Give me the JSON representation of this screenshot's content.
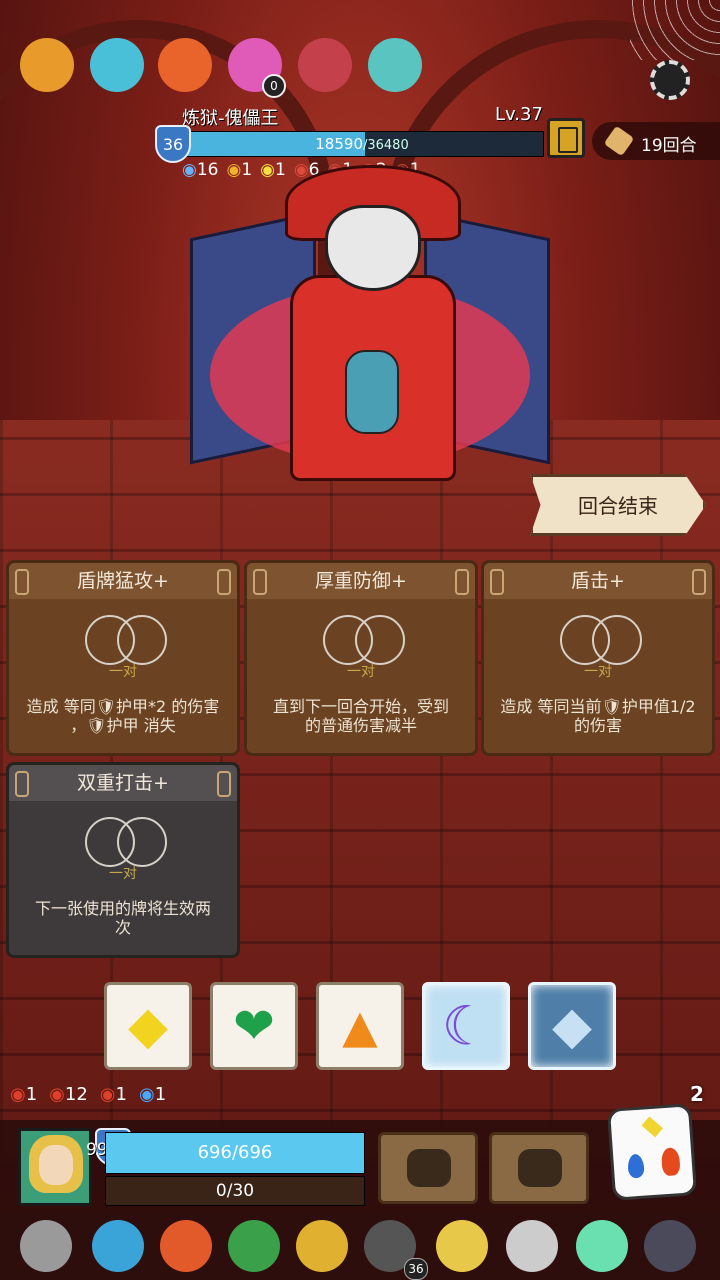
{
  "top_relics": [
    {
      "icon": "pumpkin-mask-icon",
      "color": "#e89a2a"
    },
    {
      "icon": "green-coral-icon",
      "color": "#4ac0d8"
    },
    {
      "icon": "fire-mirror-icon",
      "color": "#e8642a"
    },
    {
      "icon": "pink-orb-icon",
      "color": "#e05ab8",
      "badge": "0"
    },
    {
      "icon": "cracked-heart-icon",
      "color": "#c4404a"
    },
    {
      "icon": "teal-urn-icon",
      "color": "#5ac4c0"
    }
  ],
  "boss": {
    "name": "炼狱-傀儡王",
    "level": "Lv.37",
    "armor": "36",
    "hp_current": "18590",
    "hp_max": "/36480",
    "hp_fraction": 0.5096,
    "status": [
      {
        "icon": "target-icon",
        "value": "16",
        "color": "#6ab4ff"
      },
      {
        "icon": "shield-icon",
        "value": "1",
        "color": "#f0b030"
      },
      {
        "icon": "star-icon",
        "value": "1",
        "color": "#f4e040"
      },
      {
        "icon": "status-icon-4",
        "value": "6",
        "color": "#e04a3a"
      },
      {
        "icon": "status-icon-5",
        "value": "1",
        "color": "#d04a3a"
      },
      {
        "icon": "status-icon-6",
        "value": "2",
        "color": "#d04a3a"
      },
      {
        "icon": "status-icon-7",
        "value": "1",
        "color": "#d04a3a"
      }
    ]
  },
  "round": {
    "label": "19回合"
  },
  "end_turn": {
    "label": "回合结束"
  },
  "cards": [
    {
      "title": "盾牌猛攻+",
      "pair": "一对",
      "desc_line1": "造成 等同🛡护甲*2 的伤害",
      "desc_line2": "，🛡护甲 消失",
      "style": "brown"
    },
    {
      "title": "厚重防御+",
      "pair": "一对",
      "desc_line1": "直到下一回合开始，受到",
      "desc_line2": "的普通伤害减半",
      "style": "brown"
    },
    {
      "title": "盾击+",
      "pair": "一对",
      "desc_line1": "造成 等同当前🛡护甲值1/2",
      "desc_line2": "的伤害",
      "style": "brown"
    },
    {
      "title": "双重打击+",
      "pair": "一对",
      "desc_line1": "下一张使用的牌将生效两",
      "desc_line2": "次",
      "style": "gray"
    }
  ],
  "dice": [
    {
      "symbol": "◆",
      "color": "#f2d420",
      "state": "white"
    },
    {
      "symbol": "❤",
      "color": "#1fa04a",
      "state": "white"
    },
    {
      "symbol": "▲",
      "color": "#f08a1a",
      "state": "white"
    },
    {
      "symbol": "☾",
      "color": "#7a4ad8",
      "state": "frozen"
    },
    {
      "symbol": "◆",
      "color": "#3c5a78",
      "state": "frozen-dark"
    }
  ],
  "player_status": [
    {
      "icon": "sword-icon",
      "value": "1",
      "color": "#e0402a"
    },
    {
      "icon": "burst-icon",
      "value": "12",
      "color": "#e0402a"
    },
    {
      "icon": "claw-icon",
      "value": "1",
      "color": "#e0402a"
    },
    {
      "icon": "target-icon",
      "value": "1",
      "color": "#4aa8ff"
    }
  ],
  "dice_count": "2",
  "player": {
    "armor": "99999",
    "hp": "696/696",
    "energy": "0/30"
  },
  "skills": [
    {
      "icon": "gauntlet-skill-icon"
    },
    {
      "icon": "claw-skill-icon"
    }
  ],
  "bottom_relics": [
    {
      "icon": "stone-disc-icon",
      "color": "#9a9a9a"
    },
    {
      "icon": "blue-shield-icon",
      "color": "#3aa4d8"
    },
    {
      "icon": "meat-icon",
      "color": "#e25a2a"
    },
    {
      "icon": "green-stone-icon",
      "color": "#3aa04a"
    },
    {
      "icon": "gold-mirror-icon",
      "color": "#e0b030"
    },
    {
      "icon": "dark-shield-icon",
      "color": "#555555",
      "badge": "36"
    },
    {
      "icon": "horn-icon",
      "color": "#e8c848"
    },
    {
      "icon": "feather-icon",
      "color": "#cccccc"
    },
    {
      "icon": "crystal-icon",
      "color": "#6ae0b0"
    },
    {
      "icon": "dark-egg-icon",
      "color": "#4a4a5a"
    }
  ]
}
